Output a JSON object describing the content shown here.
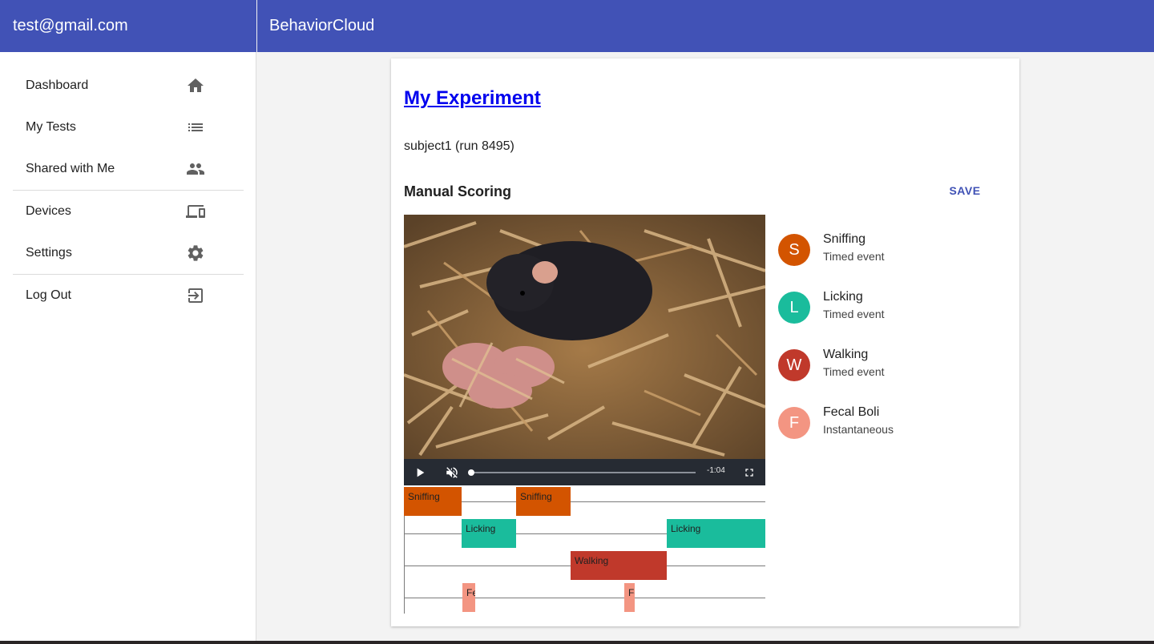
{
  "header": {
    "user_email": "test@gmail.com",
    "app_title": "BehaviorCloud"
  },
  "sidebar": {
    "items": [
      {
        "label": "Dashboard",
        "icon": "home-icon"
      },
      {
        "label": "My Tests",
        "icon": "list-icon"
      },
      {
        "label": "Shared with Me",
        "icon": "people-icon"
      },
      {
        "label": "Devices",
        "icon": "devices-icon"
      },
      {
        "label": "Settings",
        "icon": "gear-icon"
      },
      {
        "label": "Log Out",
        "icon": "logout-icon"
      }
    ]
  },
  "main": {
    "experiment_title": "My Experiment",
    "subject": "subject1 (run 8495)",
    "section_title": "Manual Scoring",
    "save_label": "SAVE"
  },
  "video": {
    "time_remaining": "-1:04",
    "progress": 0,
    "muted": true,
    "controls": [
      "play-icon",
      "volume-muted-icon",
      "fullscreen-icon"
    ]
  },
  "timeline": {
    "segments": [
      {
        "label": "Sniffing",
        "lane": 0,
        "color": "#d35400"
      },
      {
        "label": "Sniffing",
        "lane": 0,
        "color": "#d35400"
      },
      {
        "label": "Licking",
        "lane": 1,
        "color": "#1abc9c"
      },
      {
        "label": "Licking",
        "lane": 1,
        "color": "#1abc9c"
      },
      {
        "label": "Walking",
        "lane": 2,
        "color": "#c0392b"
      },
      {
        "label": "Fe",
        "lane": 3,
        "color": "#f39582"
      },
      {
        "label": "Fe",
        "lane": 3,
        "color": "#f39582"
      }
    ]
  },
  "behaviors": [
    {
      "initial": "S",
      "name": "Sniffing",
      "type": "Timed event",
      "color": "#d35400"
    },
    {
      "initial": "L",
      "name": "Licking",
      "type": "Timed event",
      "color": "#1abc9c"
    },
    {
      "initial": "W",
      "name": "Walking",
      "type": "Timed event",
      "color": "#c0392b"
    },
    {
      "initial": "F",
      "name": "Fecal Boli",
      "type": "Instantaneous",
      "color": "#f39582"
    }
  ]
}
